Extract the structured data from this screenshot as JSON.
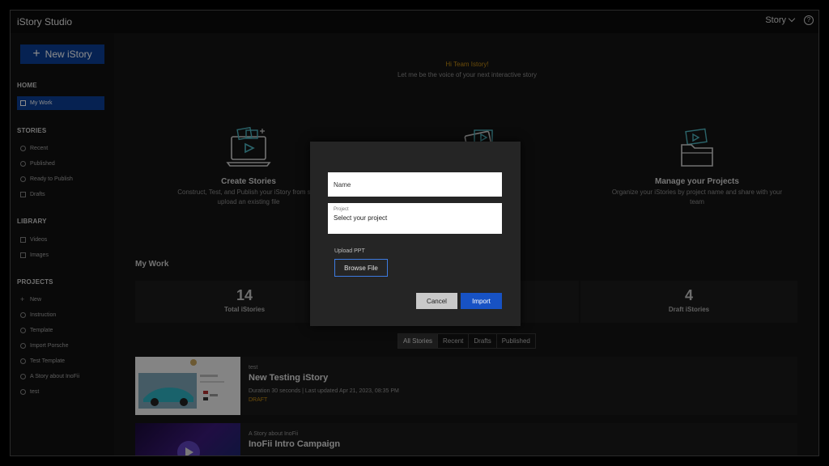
{
  "app": {
    "brand": "iStory",
    "brand_suffix": "Studio",
    "brand_sup": ""
  },
  "topbar": {
    "user_label": "Story",
    "help_glyph": "?"
  },
  "sidebar": {
    "new_button": "New iStory",
    "sections": {
      "home": "HOME",
      "stories": "STORIES",
      "library": "LIBRARY",
      "projects": "PROJECTS"
    },
    "home_items": [
      {
        "label": "My Work",
        "icon": "home-icon"
      }
    ],
    "story_items": [
      {
        "label": "Recent",
        "icon": "clock-icon"
      },
      {
        "label": "Published",
        "icon": "globe-icon"
      },
      {
        "label": "Ready to Publish",
        "icon": "check-circle-icon"
      },
      {
        "label": "Drafts",
        "icon": "document-icon"
      }
    ],
    "library_items": [
      {
        "label": "Videos",
        "icon": "video-icon"
      },
      {
        "label": "Images",
        "icon": "image-icon"
      }
    ],
    "project_items": [
      {
        "label": "New",
        "icon": "plus-icon"
      },
      {
        "label": "Instruction",
        "icon": "folder-icon"
      },
      {
        "label": "Template",
        "icon": "folder-icon"
      },
      {
        "label": "Import Porsche",
        "icon": "folder-icon"
      },
      {
        "label": "Test Template",
        "icon": "folder-icon"
      },
      {
        "label": "A Story about InoFii",
        "icon": "folder-icon"
      },
      {
        "label": "test",
        "icon": "folder-icon"
      }
    ]
  },
  "main": {
    "greeting": "Hi Team Istory!",
    "subtitle": "Let me be the voice of your next interactive story",
    "features": [
      {
        "title": "Create Stories",
        "desc_line1": "Construct, Test, and Publish your iStory from scra",
        "desc_line2": "upload an existing file"
      },
      {
        "title": "",
        "desc_line1": "s to use for",
        "desc_line2": ""
      },
      {
        "title": "Manage your Projects",
        "desc_line1": "Organize your iStories by project name and share with your",
        "desc_line2": "team"
      }
    ],
    "mywork_title": "My Work",
    "stats": [
      {
        "value": "14",
        "label": "Total iStories"
      },
      {
        "value": "4",
        "label": "Draft iStories"
      }
    ],
    "filter_tabs": [
      "All Stories",
      "Recent",
      "Drafts",
      "Published"
    ],
    "stories": [
      {
        "project": "test",
        "title": "New Testing iStory",
        "meta": "Duration 30 seconds | Last updated Apr 21, 2023, 08:35 PM",
        "status": "DRAFT"
      },
      {
        "project": "A Story about InoFii",
        "title": "InoFii Intro Campaign",
        "meta": "",
        "status": ""
      }
    ]
  },
  "modal": {
    "name_placeholder": "Name",
    "project_label": "Project",
    "project_value": "Select your project",
    "upload_label": "Upload PPT",
    "browse_button": "Browse File",
    "cancel_button": "Cancel",
    "import_button": "Import"
  },
  "colors": {
    "accent": "#0c3f96",
    "import": "#1752c4",
    "greeting": "#c28a12",
    "icon_teal": "#4fb6c2"
  }
}
